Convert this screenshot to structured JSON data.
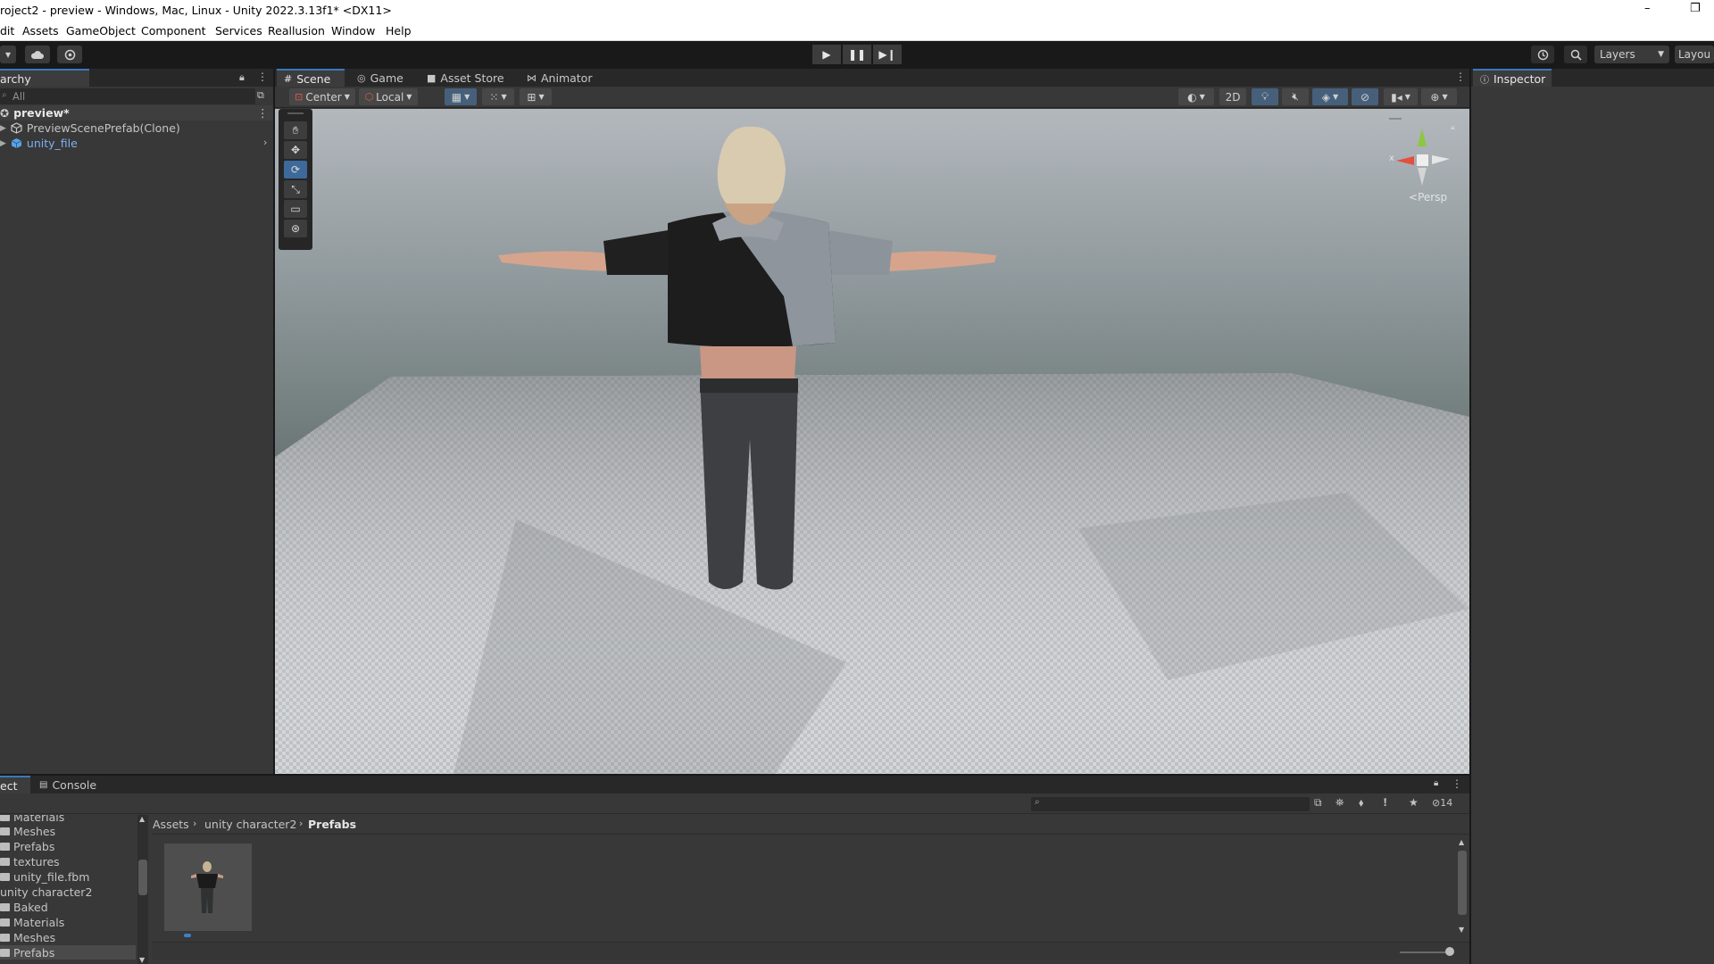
{
  "window": {
    "title": "roject2 - preview - Windows, Mac, Linux - Unity 2022.3.13f1* <DX11>",
    "minimize": "–",
    "restore": "❐"
  },
  "menu": [
    "dit",
    "Assets",
    "GameObject",
    "Component",
    "Services",
    "Reallusion",
    "Window",
    "Help"
  ],
  "toolbar": {
    "layers_label": "Layers",
    "layout_label": "Layou"
  },
  "hierarchy": {
    "tab_label": "archy",
    "search_placeholder": "All",
    "scene_name": "preview*",
    "items": [
      "PreviewScenePrefab(Clone)",
      "unity_file"
    ]
  },
  "scene_tabs": [
    "Scene",
    "Game",
    "Asset Store",
    "Animator"
  ],
  "scene_toolbar": {
    "pivot": "Center",
    "space": "Local",
    "mode_2d": "2D"
  },
  "gizmo": {
    "axis_x": "x",
    "projection": "Persp"
  },
  "inspector": {
    "tab_label": "Inspector"
  },
  "project": {
    "tabs": [
      "ect",
      "Console"
    ],
    "tree": [
      "Materials",
      "Meshes",
      "Prefabs",
      "textures",
      "unity_file.fbm",
      "unity character2",
      "Baked",
      "Materials",
      "Meshes",
      "Prefabs"
    ],
    "breadcrumb": [
      "Assets",
      "unity character2",
      "Prefabs"
    ],
    "hidden_count": "14"
  },
  "colors": {
    "accent": "#3a79bb",
    "link_blue": "#7cb1f2",
    "selected_row": "#2c5d87"
  }
}
